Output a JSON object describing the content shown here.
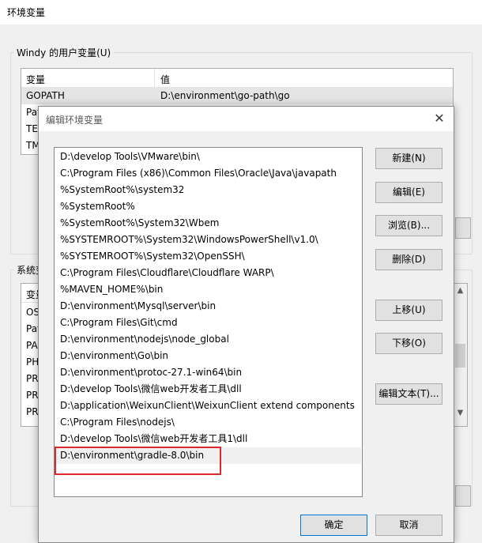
{
  "background_window": {
    "title": "环境变量",
    "user_group": {
      "label": "Windy 的用户变量(U)",
      "columns": [
        "变量",
        "值"
      ],
      "rows": [
        {
          "name": "GOPATH",
          "value": "D:\\environment\\go-path\\go"
        },
        {
          "name": "Pat",
          "value": ""
        },
        {
          "name": "TEI",
          "value": ""
        },
        {
          "name": "TM",
          "value": ""
        }
      ]
    },
    "system_group": {
      "label": "系统变",
      "header_partial": "变量",
      "rows": [
        "OS",
        "Pat",
        "PA",
        "PH",
        "PR",
        "PR",
        "PR"
      ]
    }
  },
  "dialog": {
    "title": "编辑环境变量",
    "close_glyph": "✕",
    "paths": [
      "D:\\develop Tools\\VMware\\bin\\",
      "C:\\Program Files (x86)\\Common Files\\Oracle\\Java\\javapath",
      "%SystemRoot%\\system32",
      "%SystemRoot%",
      "%SystemRoot%\\System32\\Wbem",
      "%SYSTEMROOT%\\System32\\WindowsPowerShell\\v1.0\\",
      "%SYSTEMROOT%\\System32\\OpenSSH\\",
      "C:\\Program Files\\Cloudflare\\Cloudflare WARP\\",
      "%MAVEN_HOME%\\bin",
      "D:\\environment\\Mysql\\server\\bin",
      "C:\\Program Files\\Git\\cmd",
      "D:\\environment\\nodejs\\node_global",
      "D:\\environment\\Go\\bin",
      "D:\\environment\\protoc-27.1-win64\\bin",
      "D:\\develop Tools\\微信web开发者工具\\dll",
      "D:\\application\\WeixunClient\\WeixunClient extend components",
      "C:\\Program Files\\nodejs\\",
      "D:\\develop Tools\\微信web开发者工具1\\dll",
      "D:\\environment\\gradle-8.0\\bin"
    ],
    "buttons": {
      "new": "新建(N)",
      "edit": "编辑(E)",
      "browse": "浏览(B)...",
      "delete": "删除(D)",
      "move_up": "上移(U)",
      "move_down": "下移(O)",
      "edit_text": "编辑文本(T)...",
      "ok": "确定",
      "cancel": "取消"
    },
    "highlight_color": "#e0282c"
  },
  "scroll_arrows": {
    "up": "▲",
    "down": "▼"
  }
}
